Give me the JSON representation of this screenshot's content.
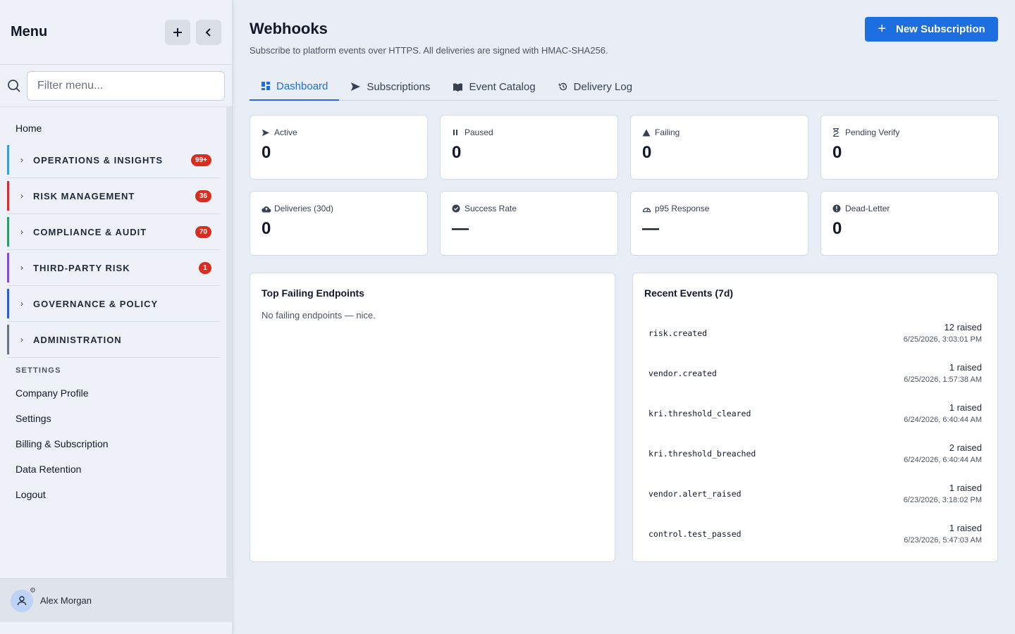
{
  "sidebar": {
    "title": "Menu",
    "filter_placeholder": "Filter menu...",
    "home": "Home",
    "groups": [
      {
        "label": "OPERATIONS & INSIGHTS",
        "badge": "99+",
        "color": "#3b9ad9"
      },
      {
        "label": "RISK MANAGEMENT",
        "badge": "36",
        "color": "#d32f2f"
      },
      {
        "label": "COMPLIANCE & AUDIT",
        "badge": "70",
        "color": "#2e9a6a"
      },
      {
        "label": "THIRD-PARTY RISK",
        "badge": "1",
        "color": "#7c4ddb"
      },
      {
        "label": "GOVERNANCE & POLICY",
        "badge": "",
        "color": "#2d5bd0"
      },
      {
        "label": "ADMINISTRATION",
        "badge": "",
        "color": "#6b7280"
      }
    ],
    "settings_label": "SETTINGS",
    "links": [
      "Company Profile",
      "Settings",
      "Billing & Subscription",
      "Data Retention",
      "Logout"
    ],
    "user": "Alex Morgan"
  },
  "header": {
    "title": "Webhooks",
    "subtitle": "Subscribe to platform events over HTTPS. All deliveries are signed with HMAC-SHA256.",
    "new_button": "New Subscription"
  },
  "tabs": [
    "Dashboard",
    "Subscriptions",
    "Event Catalog",
    "Delivery Log"
  ],
  "stats": [
    {
      "label": "Active",
      "value": "0",
      "icon": "send-icon"
    },
    {
      "label": "Paused",
      "value": "0",
      "icon": "pause-icon"
    },
    {
      "label": "Failing",
      "value": "0",
      "icon": "warning-icon"
    },
    {
      "label": "Pending Verify",
      "value": "0",
      "icon": "hourglass-icon"
    },
    {
      "label": "Deliveries (30d)",
      "value": "0",
      "icon": "cloud-upload-icon"
    },
    {
      "label": "Success Rate",
      "value": "—",
      "icon": "check-circle-icon"
    },
    {
      "label": "p95 Response",
      "value": "—",
      "icon": "gauge-icon"
    },
    {
      "label": "Dead-Letter",
      "value": "0",
      "icon": "alert-circle-icon"
    }
  ],
  "failing": {
    "title": "Top Failing Endpoints",
    "empty": "No failing endpoints — nice."
  },
  "recent": {
    "title": "Recent Events (7d)",
    "events": [
      {
        "name": "risk.created",
        "count": "12 raised",
        "time": "6/25/2026, 3:03:01 PM"
      },
      {
        "name": "vendor.created",
        "count": "1 raised",
        "time": "6/25/2026, 1:57:38 AM"
      },
      {
        "name": "kri.threshold_cleared",
        "count": "1 raised",
        "time": "6/24/2026, 6:40:44 AM"
      },
      {
        "name": "kri.threshold_breached",
        "count": "2 raised",
        "time": "6/24/2026, 6:40:44 AM"
      },
      {
        "name": "vendor.alert_raised",
        "count": "1 raised",
        "time": "6/23/2026, 3:18:02 PM"
      },
      {
        "name": "control.test_passed",
        "count": "1 raised",
        "time": "6/23/2026, 5:47:03 AM"
      }
    ]
  }
}
